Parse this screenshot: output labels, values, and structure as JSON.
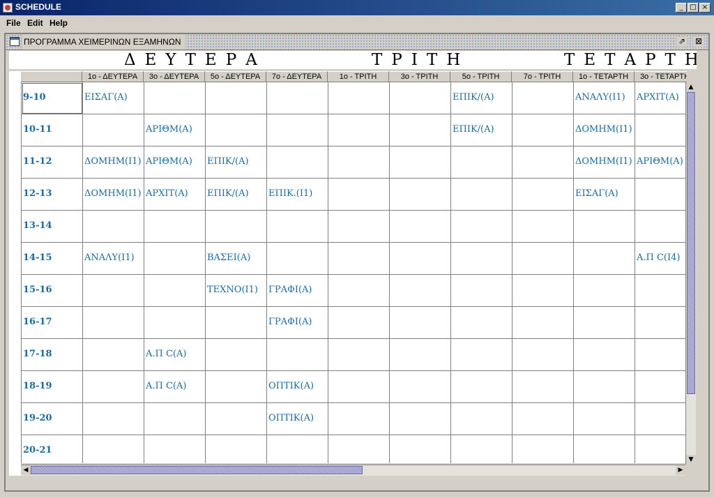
{
  "window": {
    "title": "SCHEDULE",
    "controls": [
      "_",
      "□",
      "×"
    ]
  },
  "menu": {
    "items": [
      "File",
      "Edit",
      "Help"
    ]
  },
  "internal_frame": {
    "title": "ΠΡΟΓΡΑΜΜΑ ΧΕΙΜΕΡΙΝΩΝ ΕΞΑΜΗΝΩΝ"
  },
  "days": [
    "ΔΕΥΤΕΡΑ",
    "ΤΡΙΤΗ",
    "ΤΕΤΑΡΤΗ"
  ],
  "columns": [
    "",
    "1ο - ΔΕΥΤΕΡΑ",
    "3ο - ΔΕΥΤΕΡΑ",
    "5ο - ΔΕΥΤΕΡΑ",
    "7ο - ΔΕΥΤΕΡΑ",
    "1ο - ΤΡΙΤΗ",
    "3ο - ΤΡΙΤΗ",
    "5ο - ΤΡΙΤΗ",
    "7ο - ΤΡΙΤΗ",
    "1ο - ΤΕΤΑΡΤΗ",
    "3ο - ΤΕΤΑΡΤΗ"
  ],
  "rows": [
    [
      "9-10",
      "ΕΙΣΑΓ(Α)",
      "",
      "",
      "",
      "",
      "",
      "ΕΠΙΚ/(Α)",
      "",
      "ΑΝΑΛΥ(Ι1)",
      "ΑΡΧΙΤ(Α)"
    ],
    [
      "10-11",
      "",
      "ΑΡΙΘΜ(Α)",
      "",
      "",
      "",
      "",
      "ΕΠΙΚ/(Α)",
      "",
      "ΔΟΜΗΜ(Ι1)",
      ""
    ],
    [
      "11-12",
      "ΔΟΜΗΜ(Ι1)",
      "ΑΡΙΘΜ(Α)",
      "ΕΠΙΚ/(Α)",
      "",
      "",
      "",
      "",
      "",
      "ΔΟΜΗΜ(Ι1)",
      "ΑΡΙΘΜ(Α)"
    ],
    [
      "12-13",
      "ΔΟΜΗΜ(Ι1)",
      "ΑΡΧΙΤ(Α)",
      "ΕΠΙΚ/(Α)",
      "ΕΠΙΚ.(Ι1)",
      "",
      "",
      "",
      "",
      "ΕΙΣΑΓ(Α)",
      ""
    ],
    [
      "13-14",
      "",
      "",
      "",
      "",
      "",
      "",
      "",
      "",
      "",
      ""
    ],
    [
      "14-15",
      "ΑΝΑΛΥ(Ι1)",
      "",
      "ΒΑΣΕΙ(Α)",
      "",
      "",
      "",
      "",
      "",
      "",
      "Α.Π C(Ι4)"
    ],
    [
      "15-16",
      "",
      "",
      "ΤΕΧΝΟ(Ι1)",
      "ΓΡΑΦΙ(Α)",
      "",
      "",
      "",
      "",
      "",
      ""
    ],
    [
      "16-17",
      "",
      "",
      "",
      "ΓΡΑΦΙ(Α)",
      "",
      "",
      "",
      "",
      "",
      ""
    ],
    [
      "17-18",
      "",
      "Α.Π C(Α)",
      "",
      "",
      "",
      "",
      "",
      "",
      "",
      ""
    ],
    [
      "18-19",
      "",
      "Α.Π C(Α)",
      "",
      "ΟΠΤΙΚ(Α)",
      "",
      "",
      "",
      "",
      "",
      ""
    ],
    [
      "19-20",
      "",
      "",
      "",
      "ΟΠΤΙΚ(Α)",
      "",
      "",
      "",
      "",
      "",
      ""
    ],
    [
      "20-21",
      "",
      "",
      "",
      "",
      "",
      "",
      "",
      "",
      "",
      ""
    ]
  ],
  "colors": {
    "cell_text": "#1a6aa0",
    "title_gradient_start": "#0a246a",
    "title_gradient_end": "#3a6ea5",
    "scroll_thumb": "#b0b0d6"
  },
  "icons": {
    "app": "schedule-app-icon",
    "frame": "window-icon",
    "restore": "restore-icon",
    "close": "close-icon"
  }
}
